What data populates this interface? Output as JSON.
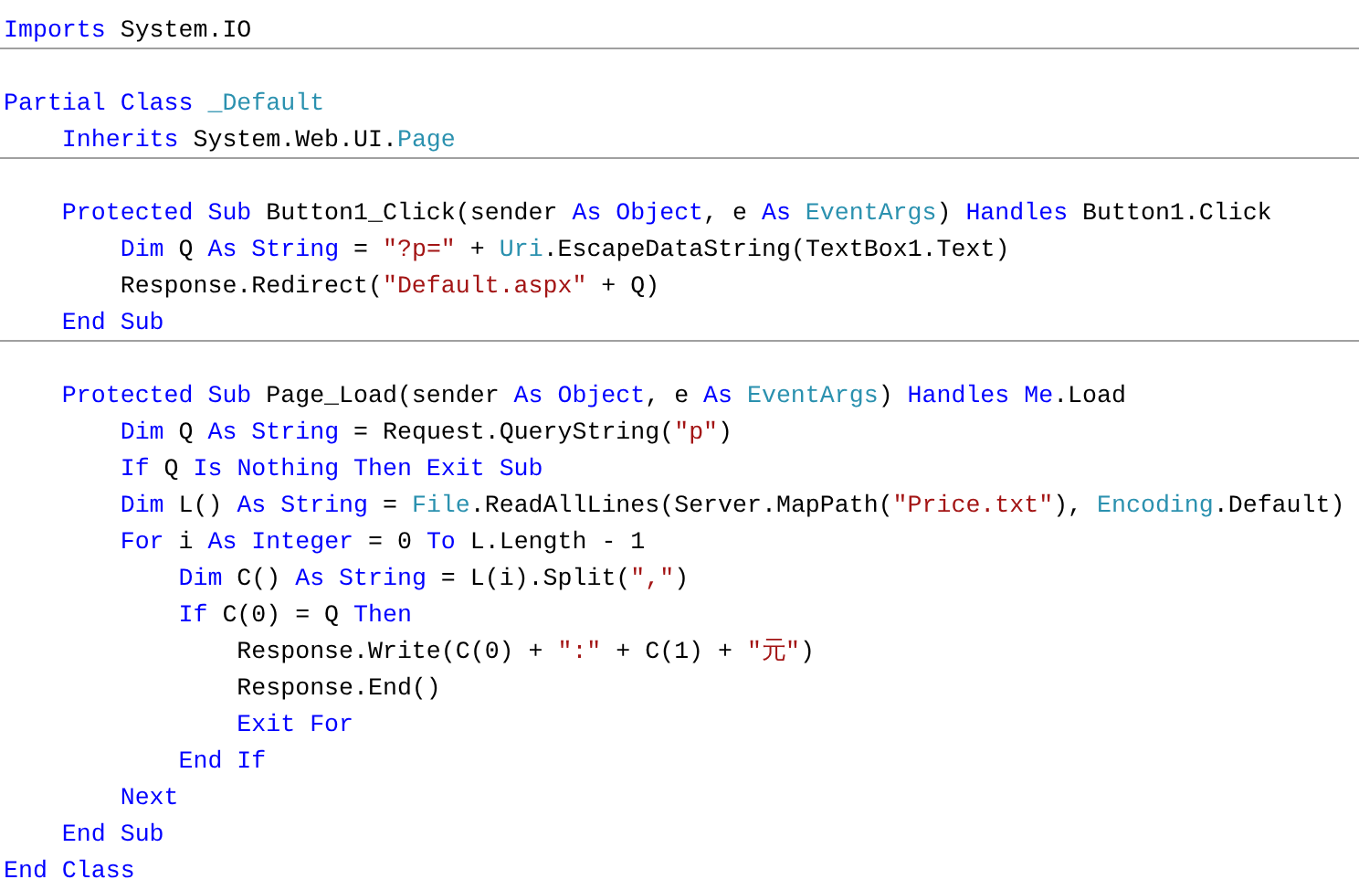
{
  "editor": {
    "lines": [
      {
        "kind": "code",
        "separator_below": true,
        "tokens": [
          {
            "kind": "keyword",
            "text": "Imports"
          },
          {
            "kind": "plain",
            "text": " System.IO"
          }
        ]
      },
      {
        "kind": "blank"
      },
      {
        "kind": "code",
        "separator_below": false,
        "tokens": [
          {
            "kind": "keyword",
            "text": "Partial Class"
          },
          {
            "kind": "type",
            "text": " _Default"
          }
        ]
      },
      {
        "kind": "code",
        "separator_below": true,
        "tokens": [
          {
            "kind": "keyword",
            "text": "    Inherits"
          },
          {
            "kind": "plain",
            "text": " System.Web.UI."
          },
          {
            "kind": "type",
            "text": "Page"
          }
        ]
      },
      {
        "kind": "blank"
      },
      {
        "kind": "code",
        "separator_below": false,
        "tokens": [
          {
            "kind": "keyword",
            "text": "    Protected Sub"
          },
          {
            "kind": "plain",
            "text": " Button1_Click(sender "
          },
          {
            "kind": "keyword",
            "text": "As Object"
          },
          {
            "kind": "plain",
            "text": ", e "
          },
          {
            "kind": "keyword",
            "text": "As"
          },
          {
            "kind": "type",
            "text": " EventArgs"
          },
          {
            "kind": "plain",
            "text": ") "
          },
          {
            "kind": "keyword",
            "text": "Handles"
          },
          {
            "kind": "plain",
            "text": " Button1.Click"
          }
        ]
      },
      {
        "kind": "code",
        "separator_below": false,
        "tokens": [
          {
            "kind": "keyword",
            "text": "        Dim"
          },
          {
            "kind": "plain",
            "text": " Q "
          },
          {
            "kind": "keyword",
            "text": "As String"
          },
          {
            "kind": "plain",
            "text": " = "
          },
          {
            "kind": "string",
            "text": "\"?p=\""
          },
          {
            "kind": "plain",
            "text": " + "
          },
          {
            "kind": "type",
            "text": "Uri"
          },
          {
            "kind": "plain",
            "text": ".EscapeDataString(TextBox1.Text)"
          }
        ]
      },
      {
        "kind": "code",
        "separator_below": false,
        "tokens": [
          {
            "kind": "plain",
            "text": "        Response.Redirect("
          },
          {
            "kind": "string",
            "text": "\"Default.aspx\""
          },
          {
            "kind": "plain",
            "text": " + Q)"
          }
        ]
      },
      {
        "kind": "code",
        "separator_below": true,
        "tokens": [
          {
            "kind": "keyword",
            "text": "    End Sub"
          }
        ]
      },
      {
        "kind": "blank"
      },
      {
        "kind": "code",
        "separator_below": false,
        "tokens": [
          {
            "kind": "keyword",
            "text": "    Protected Sub"
          },
          {
            "kind": "plain",
            "text": " Page_Load(sender "
          },
          {
            "kind": "keyword",
            "text": "As Object"
          },
          {
            "kind": "plain",
            "text": ", e "
          },
          {
            "kind": "keyword",
            "text": "As"
          },
          {
            "kind": "type",
            "text": " EventArgs"
          },
          {
            "kind": "plain",
            "text": ") "
          },
          {
            "kind": "keyword",
            "text": "Handles Me"
          },
          {
            "kind": "plain",
            "text": ".Load"
          }
        ]
      },
      {
        "kind": "code",
        "separator_below": false,
        "tokens": [
          {
            "kind": "keyword",
            "text": "        Dim"
          },
          {
            "kind": "plain",
            "text": " Q "
          },
          {
            "kind": "keyword",
            "text": "As String"
          },
          {
            "kind": "plain",
            "text": " = Request.QueryString("
          },
          {
            "kind": "string",
            "text": "\"p\""
          },
          {
            "kind": "plain",
            "text": ")"
          }
        ]
      },
      {
        "kind": "code",
        "separator_below": false,
        "tokens": [
          {
            "kind": "keyword",
            "text": "        If"
          },
          {
            "kind": "plain",
            "text": " Q "
          },
          {
            "kind": "keyword",
            "text": "Is Nothing Then Exit Sub"
          }
        ]
      },
      {
        "kind": "code",
        "separator_below": false,
        "tokens": [
          {
            "kind": "keyword",
            "text": "        Dim"
          },
          {
            "kind": "plain",
            "text": " L() "
          },
          {
            "kind": "keyword",
            "text": "As String"
          },
          {
            "kind": "plain",
            "text": " = "
          },
          {
            "kind": "type",
            "text": "File"
          },
          {
            "kind": "plain",
            "text": ".ReadAllLines(Server.MapPath("
          },
          {
            "kind": "string",
            "text": "\"Price.txt\""
          },
          {
            "kind": "plain",
            "text": "), "
          },
          {
            "kind": "type",
            "text": "Encoding"
          },
          {
            "kind": "plain",
            "text": ".Default)"
          }
        ]
      },
      {
        "kind": "code",
        "separator_below": false,
        "tokens": [
          {
            "kind": "keyword",
            "text": "        For"
          },
          {
            "kind": "plain",
            "text": " i "
          },
          {
            "kind": "keyword",
            "text": "As Integer"
          },
          {
            "kind": "plain",
            "text": " = 0 "
          },
          {
            "kind": "keyword",
            "text": "To"
          },
          {
            "kind": "plain",
            "text": " L.Length - 1"
          }
        ]
      },
      {
        "kind": "code",
        "separator_below": false,
        "tokens": [
          {
            "kind": "keyword",
            "text": "            Dim"
          },
          {
            "kind": "plain",
            "text": " C() "
          },
          {
            "kind": "keyword",
            "text": "As String"
          },
          {
            "kind": "plain",
            "text": " = L(i).Split("
          },
          {
            "kind": "string",
            "text": "\",\""
          },
          {
            "kind": "plain",
            "text": ")"
          }
        ]
      },
      {
        "kind": "code",
        "separator_below": false,
        "tokens": [
          {
            "kind": "keyword",
            "text": "            If"
          },
          {
            "kind": "plain",
            "text": " C(0) = Q "
          },
          {
            "kind": "keyword",
            "text": "Then"
          }
        ]
      },
      {
        "kind": "code",
        "separator_below": false,
        "tokens": [
          {
            "kind": "plain",
            "text": "                Response.Write(C(0) + "
          },
          {
            "kind": "string",
            "text": "\":\""
          },
          {
            "kind": "plain",
            "text": " + C(1) + "
          },
          {
            "kind": "string",
            "text": "\"元\""
          },
          {
            "kind": "plain",
            "text": ")"
          }
        ]
      },
      {
        "kind": "code",
        "separator_below": false,
        "tokens": [
          {
            "kind": "plain",
            "text": "                Response.End()"
          }
        ]
      },
      {
        "kind": "code",
        "separator_below": false,
        "tokens": [
          {
            "kind": "keyword",
            "text": "                Exit For"
          }
        ]
      },
      {
        "kind": "code",
        "separator_below": false,
        "tokens": [
          {
            "kind": "keyword",
            "text": "            End If"
          }
        ]
      },
      {
        "kind": "code",
        "separator_below": false,
        "tokens": [
          {
            "kind": "keyword",
            "text": "        Next"
          }
        ]
      },
      {
        "kind": "code",
        "separator_below": false,
        "tokens": [
          {
            "kind": "keyword",
            "text": "    End Sub"
          }
        ]
      },
      {
        "kind": "code",
        "separator_below": false,
        "tokens": [
          {
            "kind": "keyword",
            "text": "End Class"
          }
        ]
      }
    ]
  }
}
